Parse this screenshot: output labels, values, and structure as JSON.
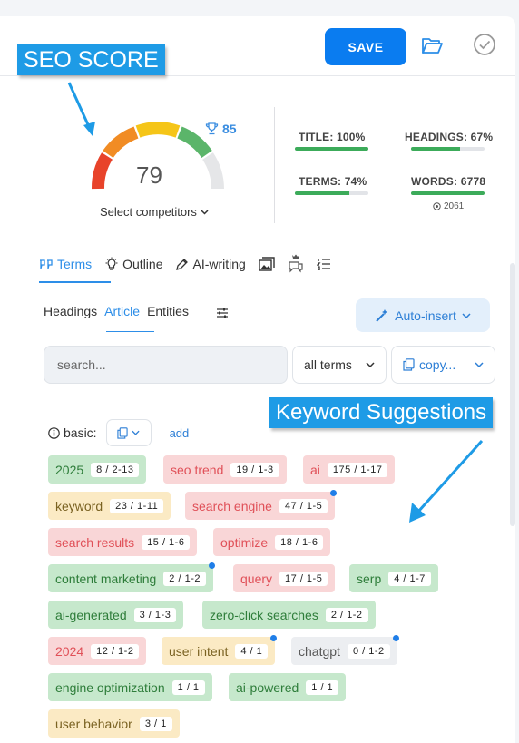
{
  "header": {
    "save_label": "SAVE"
  },
  "callouts": {
    "seo_score": "SEO SCORE",
    "keyword_suggestions": "Keyword Suggestions"
  },
  "score": {
    "value": "79",
    "target": "85",
    "select_competitors": "Select competitors"
  },
  "metrics": [
    {
      "label": "TITLE: 100%",
      "fill": 100
    },
    {
      "label": "HEADINGS: 67%",
      "fill": 67
    },
    {
      "label": "TERMS: 74%",
      "fill": 74
    },
    {
      "label": "WORDS: 6778",
      "fill": 100,
      "sub": "2061"
    }
  ],
  "tabs": {
    "terms": "Terms",
    "outline": "Outline",
    "ai_writing": "AI-writing"
  },
  "subtabs": {
    "headings": "Headings",
    "article": "Article",
    "entities": "Entities"
  },
  "auto_insert": "Auto-insert",
  "search": {
    "placeholder": "search..."
  },
  "filters": {
    "terms": "all terms",
    "copy": "copy..."
  },
  "basic": {
    "label": "basic:",
    "add": "add"
  },
  "keywords": [
    {
      "text": "2025",
      "count": "8 / 2-13",
      "color": "green"
    },
    {
      "text": "seo trend",
      "count": "19 / 1-3",
      "color": "red"
    },
    {
      "text": "ai",
      "count": "175 / 1-17",
      "color": "red"
    },
    {
      "text": "keyword",
      "count": "23 / 1-11",
      "color": "yellow"
    },
    {
      "text": "search engine",
      "count": "47 / 1-5",
      "color": "red",
      "dot": true
    },
    {
      "text": "search results",
      "count": "15 / 1-6",
      "color": "red"
    },
    {
      "text": "optimize",
      "count": "18 / 1-6",
      "color": "red"
    },
    {
      "text": "content marketing",
      "count": "2 / 1-2",
      "color": "green",
      "dot": true
    },
    {
      "text": "query",
      "count": "17 / 1-5",
      "color": "red"
    },
    {
      "text": "serp",
      "count": "4 / 1-7",
      "color": "green"
    },
    {
      "text": "ai-generated",
      "count": "3 / 1-3",
      "color": "green"
    },
    {
      "text": "zero-click searches",
      "count": "2 / 1-2",
      "color": "green"
    },
    {
      "text": "2024",
      "count": "12 / 1-2",
      "color": "red"
    },
    {
      "text": "user intent",
      "count": "4 / 1",
      "color": "yellow",
      "dot": true
    },
    {
      "text": "chatgpt",
      "count": "0 / 1-2",
      "color": "gray",
      "dot": true
    },
    {
      "text": "engine optimization",
      "count": "1 / 1",
      "color": "green"
    },
    {
      "text": "ai-powered",
      "count": "1 / 1",
      "color": "green"
    },
    {
      "text": "user behavior",
      "count": "3 / 1",
      "color": "yellow"
    }
  ]
}
